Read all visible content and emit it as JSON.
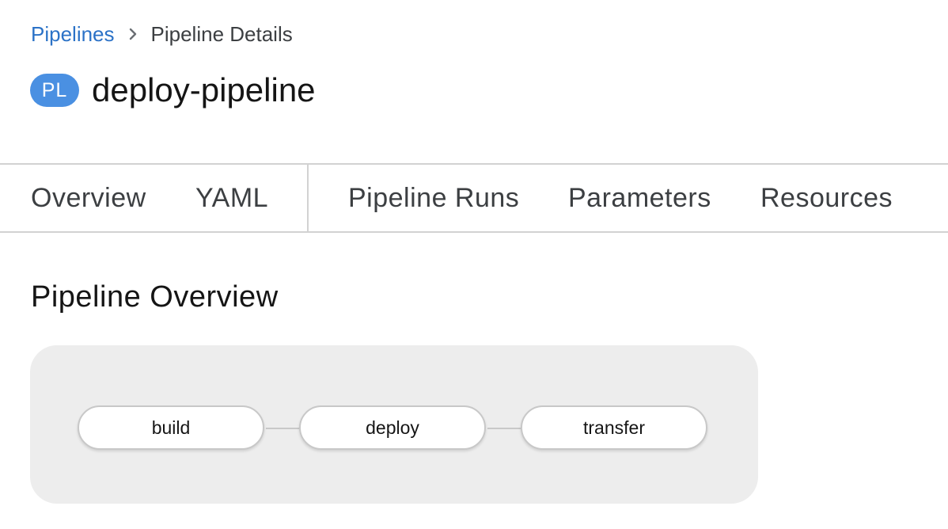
{
  "breadcrumb": {
    "parent": "Pipelines",
    "separator_icon": "chevron-right-icon",
    "current": "Pipeline Details"
  },
  "header": {
    "badge": "PL",
    "title": "deploy-pipeline"
  },
  "tabs": [
    {
      "label": "Overview"
    },
    {
      "label": "YAML"
    },
    {
      "label": "Pipeline Runs"
    },
    {
      "label": "Parameters"
    },
    {
      "label": "Resources"
    }
  ],
  "overview": {
    "title": "Pipeline Overview",
    "tasks": [
      {
        "label": "build"
      },
      {
        "label": "deploy"
      },
      {
        "label": "transfer"
      }
    ]
  },
  "colors": {
    "link": "#2b72c7",
    "badge": "#4a90e2",
    "graph_bg": "#ededed"
  }
}
